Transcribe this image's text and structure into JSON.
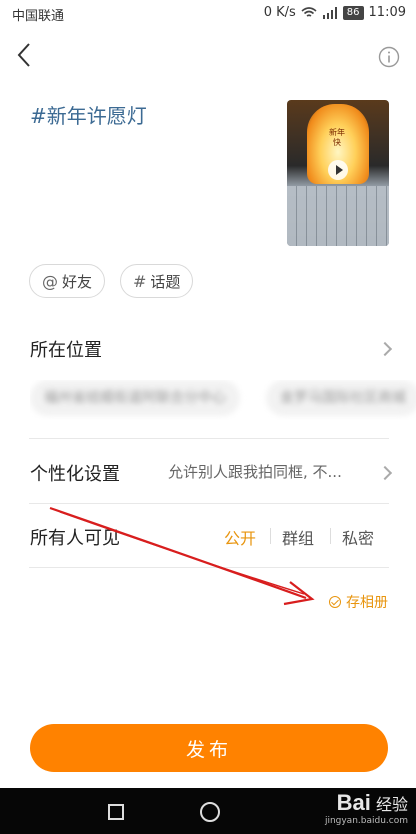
{
  "status_bar": {
    "carrier": "中国联通",
    "network_speed": "0 K/s",
    "battery": "86",
    "time": "11:09"
  },
  "post": {
    "topic_text": "#新年许愿灯",
    "thumbnail_caption": "新年快"
  },
  "chips": {
    "friend": "好友",
    "topic": "话题"
  },
  "location": {
    "title": "所在位置",
    "suggestions": [
      "福州省结婚街道阿联合分中心",
      "金罗马国际社区商城"
    ]
  },
  "personalization": {
    "title": "个性化设置",
    "value": "允许别人跟我拍同框, 不..."
  },
  "visibility": {
    "title": "所有人可见",
    "options": [
      "公开",
      "群组",
      "私密"
    ],
    "selected": "公开"
  },
  "save_album": "存相册",
  "publish_button": "发布",
  "watermark": {
    "brand": "Bai",
    "sub": "经验",
    "url": "jingyan.baidu.com"
  },
  "colors": {
    "accent": "#ff8200",
    "topic": "#3c6a93",
    "selected_option": "#e8950f",
    "annotation_arrow": "#d81e1e"
  }
}
